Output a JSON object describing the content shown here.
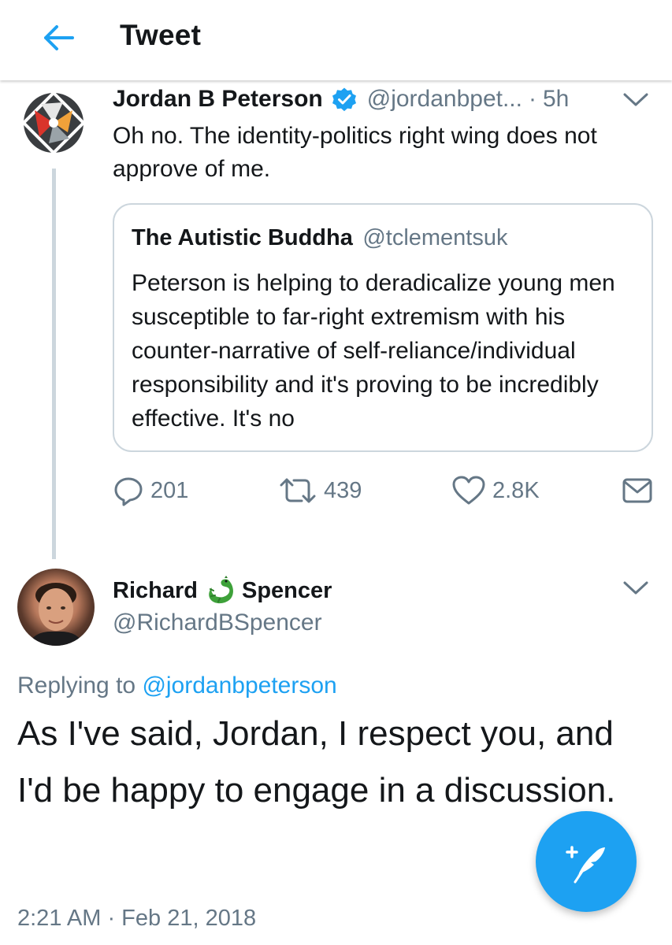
{
  "header": {
    "title": "Tweet",
    "back_icon": "arrow-left-icon"
  },
  "colors": {
    "accent": "#1da1f2",
    "secondary_text": "#657786",
    "primary_text": "#14171a",
    "border": "#ccd6dd"
  },
  "parent_tweet": {
    "author_name": "Jordan B Peterson",
    "verified": true,
    "handle": "@jordanbpet...",
    "separator": "·",
    "time_ago": "5h",
    "text": "Oh no. The identity-politics right wing does not approve of me.",
    "quoted": {
      "author_name": "The Autistic Buddha",
      "handle": "@tclementsuk",
      "text": "Peterson is helping to deradicalize young men susceptible to far-right extremism with his counter-narrative of self-reliance/individual responsibility and it's proving to be incredibly effective. It's no"
    },
    "actions": {
      "replies": "201",
      "retweets": "439",
      "likes": "2.8K"
    }
  },
  "reply_tweet": {
    "name_first": "Richard",
    "name_emoji": "dragon-emoji-icon",
    "name_last": "Spencer",
    "handle": "@RichardBSpencer",
    "replying_label": "Replying to",
    "replying_mention": "@jordanbpeterson",
    "text": "As I've said, Jordan, I respect you, and I'd be happy to engage in a discussion.",
    "timestamp": "2:21 AM · Feb 21, 2018"
  },
  "compose_button": {
    "icon": "compose-feather-icon"
  }
}
